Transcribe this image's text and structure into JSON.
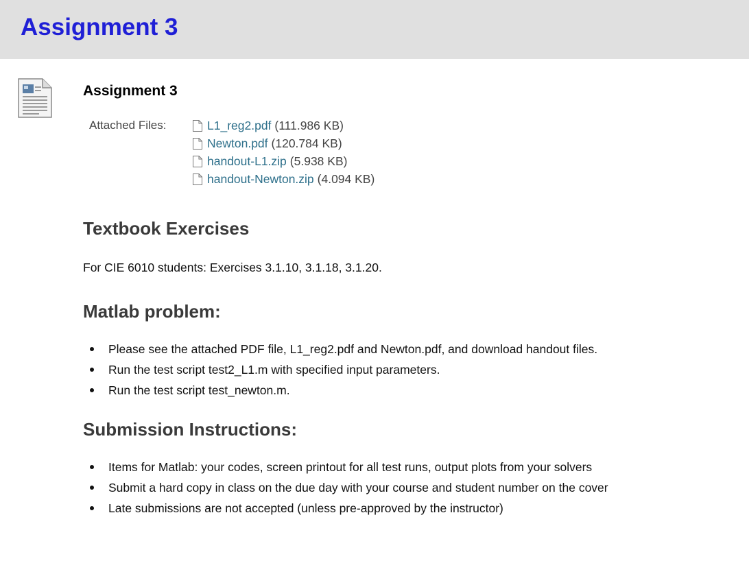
{
  "header": {
    "title": "Assignment 3"
  },
  "item": {
    "title": "Assignment 3",
    "attached_files_label": "Attached Files:",
    "files": [
      {
        "name": "L1_reg2.pdf",
        "size": "(111.986 KB)"
      },
      {
        "name": "Newton.pdf",
        "size": "(120.784 KB)"
      },
      {
        "name": "handout-L1.zip",
        "size": "(5.938 KB)"
      },
      {
        "name": "handout-Newton.zip",
        "size": "(4.094 KB)"
      }
    ]
  },
  "textbook": {
    "heading": "Textbook Exercises",
    "text": "For CIE 6010 students: Exercises 3.1.10, 3.1.18, 3.1.20."
  },
  "matlab": {
    "heading": "Matlab problem:",
    "bullets": [
      "Please see the attached PDF file, L1_reg2.pdf and Newton.pdf, and download handout files.",
      "Run the test script test2_L1.m with specified input parameters.",
      "Run the test script test_newton.m."
    ]
  },
  "submission": {
    "heading": "Submission Instructions:",
    "bullets": [
      "Items for Matlab: your codes, screen printout for all test runs, output plots from your solvers",
      "Submit a hard copy in class on the due day with your course and student number on the cover",
      "Late submissions are not accepted (unless pre-approved by the instructor)"
    ]
  },
  "colors": {
    "header_bg": "#e0e0e0",
    "header_title": "#1f1fd6",
    "link": "#2d6f8a"
  }
}
